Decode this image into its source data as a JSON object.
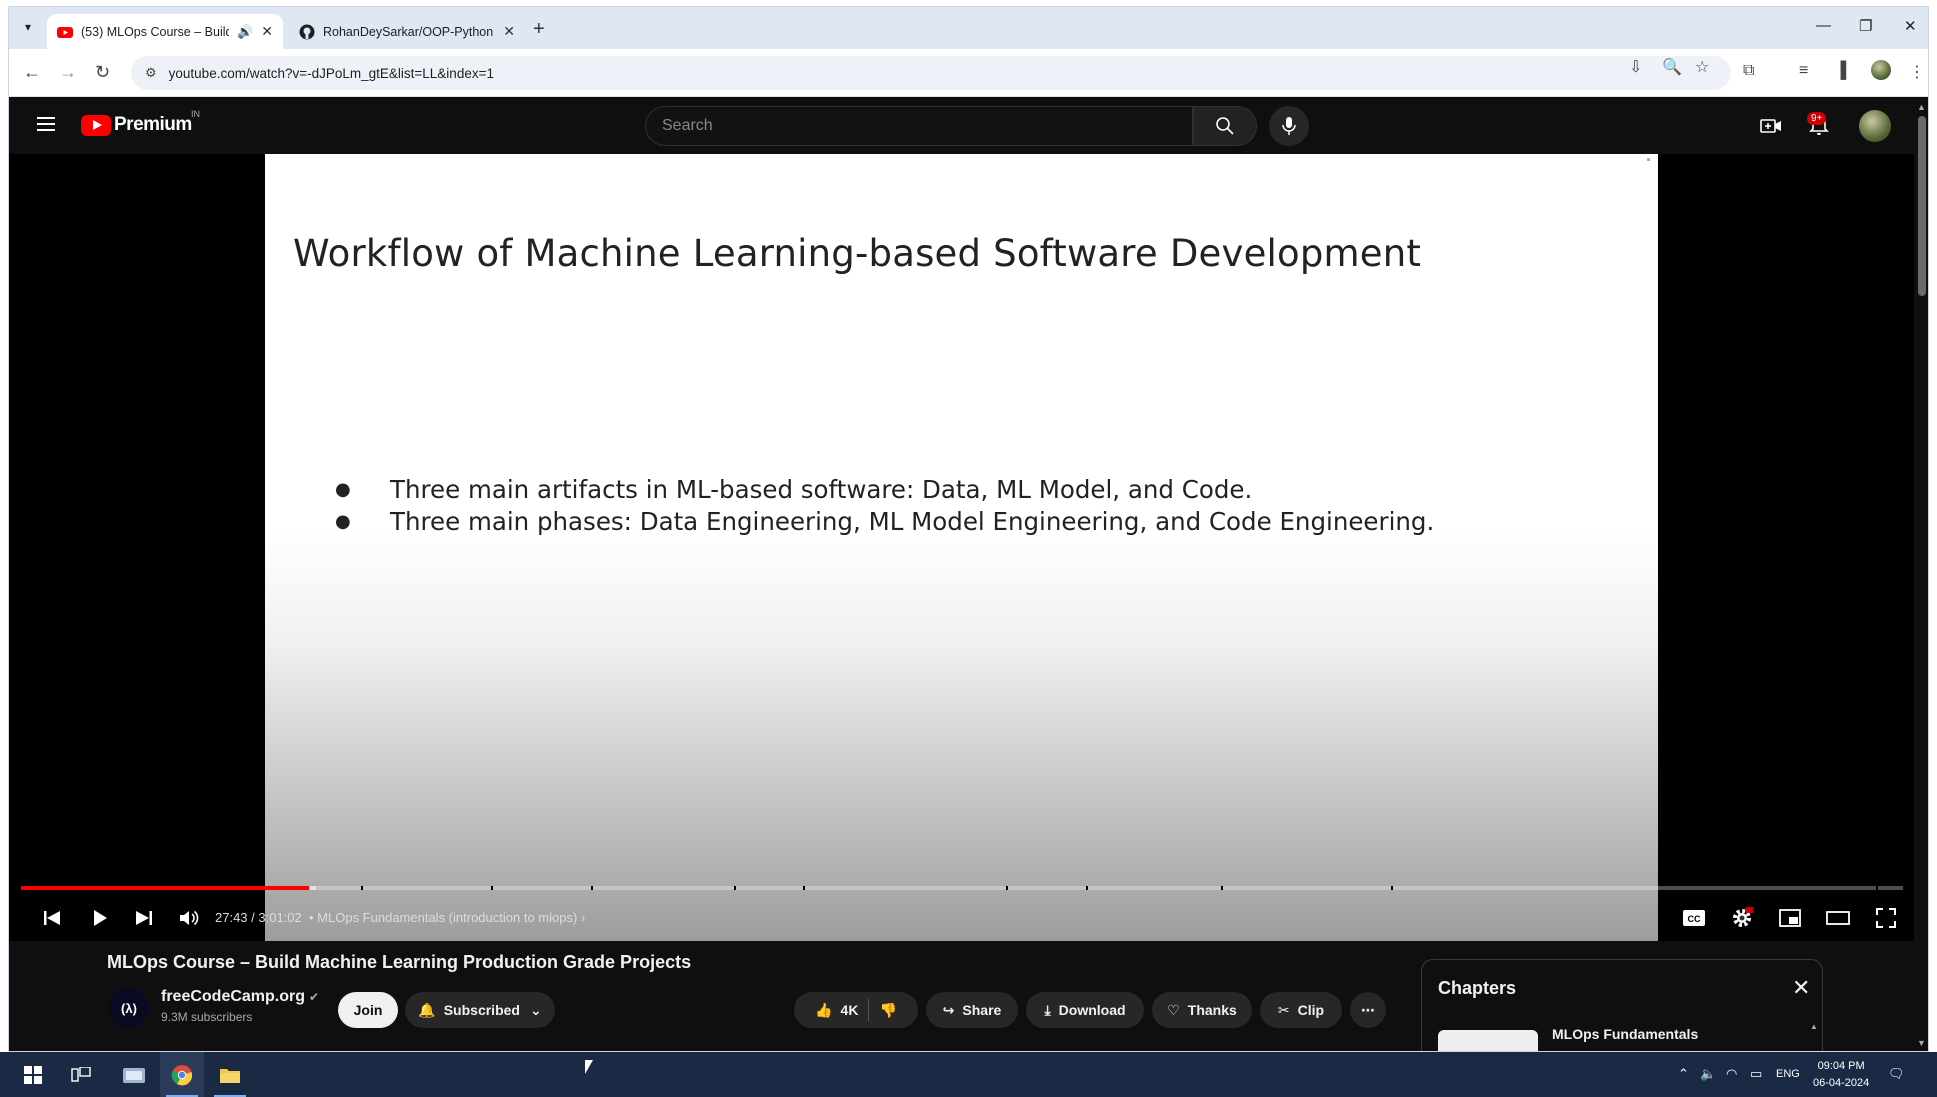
{
  "browser": {
    "tabs": [
      {
        "title": "(53) MLOps Course – Build",
        "active": true
      },
      {
        "title": "RohanDeySarkar/OOP-Python",
        "active": false
      }
    ],
    "url": "youtube.com/watch?v=-dJPoLm_gtE&list=LL&index=1"
  },
  "youtube": {
    "brand": "Premium",
    "country": "IN",
    "search_placeholder": "Search",
    "notification_count": "9+"
  },
  "slide": {
    "title": "Workflow of Machine Learning-based Software Development",
    "bullets": [
      "Three main artifacts in ML-based software: Data, ML Model, and Code.",
      "Three main phases: Data Engineering, ML Model Engineering, and Code Engineering."
    ]
  },
  "player": {
    "current_time": "27:43",
    "duration": "3:01:02",
    "time_display": "27:43 / 3:01:02",
    "chapter_label": "MLOps Fundamentals (introduction to mlops)",
    "progress_fraction": 0.153,
    "buffer_fraction": 0.157
  },
  "video": {
    "title": "MLOps Course – Build Machine Learning Production Grade Projects",
    "channel": "freeCodeCamp.org",
    "subscribers": "9.3M subscribers",
    "join_label": "Join",
    "subscribed_label": "Subscribed",
    "likes": "4K",
    "share_label": "Share",
    "download_label": "Download",
    "thanks_label": "Thanks",
    "clip_label": "Clip"
  },
  "chapters": {
    "heading": "Chapters",
    "first_item": "MLOps Fundamentals"
  },
  "taskbar": {
    "language": "ENG",
    "time": "09:04 PM",
    "date": "06-04-2024"
  }
}
